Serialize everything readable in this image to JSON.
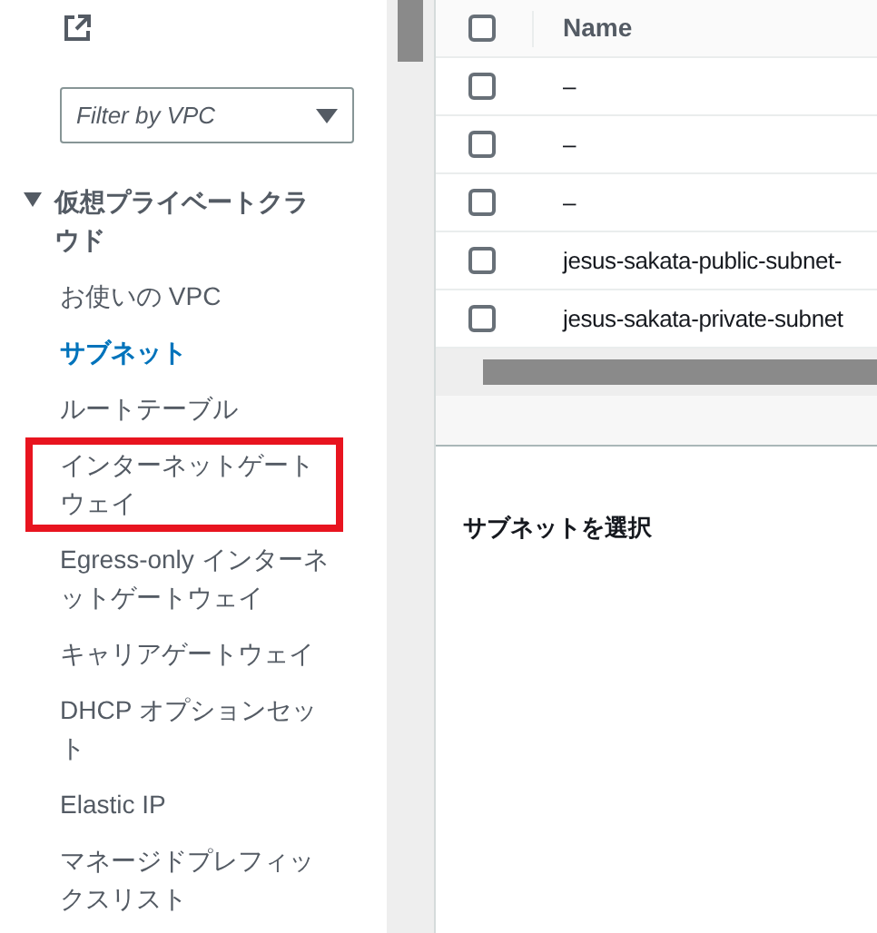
{
  "sidebar": {
    "filter": {
      "placeholder": "Filter by VPC"
    },
    "section": {
      "title": "仮想プライベートクラウド",
      "expanded": true,
      "items": [
        {
          "label": "お使いの VPC",
          "selected": false,
          "highlighted": false
        },
        {
          "label": "サブネット",
          "selected": true,
          "highlighted": false
        },
        {
          "label": "ルートテーブル",
          "selected": false,
          "highlighted": false
        },
        {
          "label": "インターネットゲートウェイ",
          "selected": false,
          "highlighted": true
        },
        {
          "label": "Egress-only インターネットゲートウェイ",
          "selected": false,
          "highlighted": false
        },
        {
          "label": "キャリアゲートウェイ",
          "selected": false,
          "highlighted": false
        },
        {
          "label": "DHCP オプションセット",
          "selected": false,
          "highlighted": false
        },
        {
          "label": "Elastic IP",
          "selected": false,
          "highlighted": false
        },
        {
          "label": "マネージドプレフィックスリスト",
          "selected": false,
          "highlighted": false
        }
      ]
    }
  },
  "table": {
    "header": {
      "label": "Name",
      "checked": false
    },
    "rows": [
      {
        "name": "–",
        "checked": false
      },
      {
        "name": "–",
        "checked": false
      },
      {
        "name": "–",
        "checked": false
      },
      {
        "name": "jesus-sakata-public-subnet-",
        "checked": false
      },
      {
        "name": "jesus-sakata-private-subnet",
        "checked": false
      }
    ]
  },
  "details": {
    "message": "サブネットを選択"
  }
}
